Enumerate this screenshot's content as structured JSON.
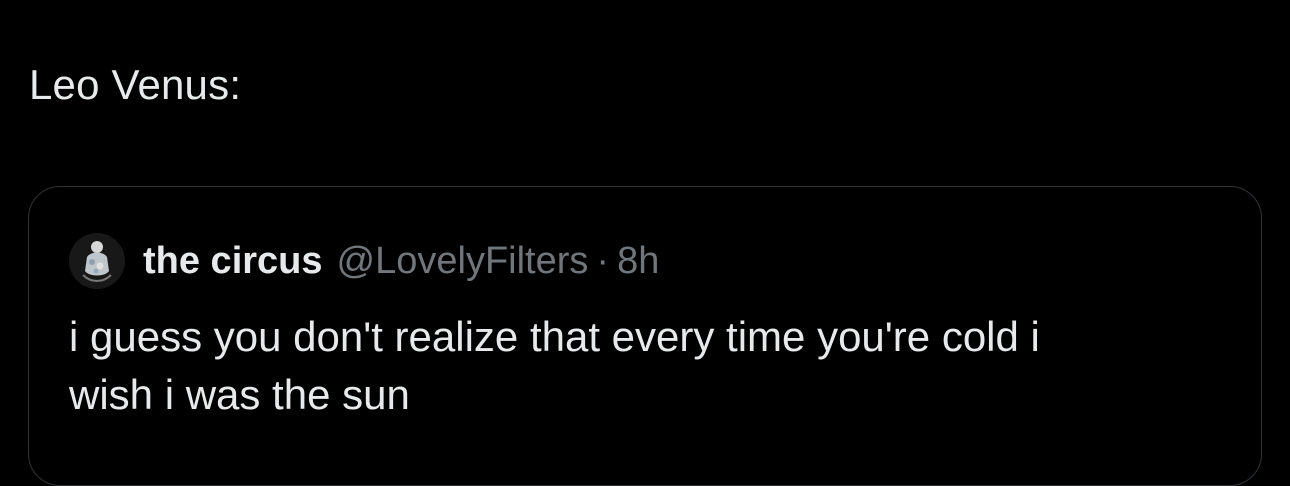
{
  "post": {
    "text": "Leo Venus:"
  },
  "quoted_post": {
    "display_name": "the circus",
    "handle": "@LovelyFilters",
    "separator": "·",
    "time": "8h",
    "text_line1": "i guess you don't realize that every time you're cold i",
    "text_line2": "wish i was the sun",
    "avatar_icon": "profile-avatar"
  },
  "colors": {
    "background": "#000000",
    "primary_text": "#e7e9ea",
    "secondary_text": "#71767b",
    "border": "#2f3336"
  }
}
